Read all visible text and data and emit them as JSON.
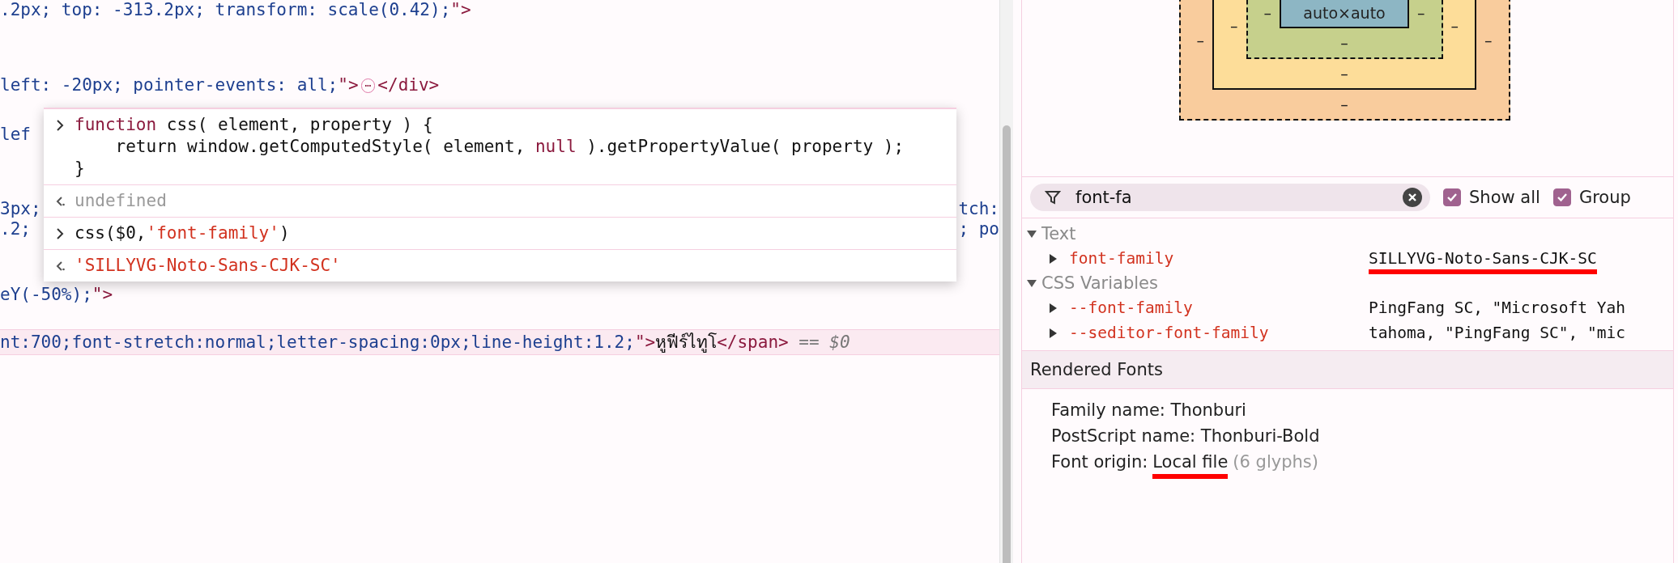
{
  "elements_tree": {
    "lines": [
      {
        "selected": false,
        "left": [
          {
            "kind": "value",
            "text": ".2px; top: -313.2px; transform: scale(0.42);"
          },
          {
            "kind": "tag",
            "text": "\">"
          }
        ]
      },
      {
        "selected": false,
        "left": [
          {
            "kind": "value",
            "text": "left: -20px; pointer-events: all;"
          },
          {
            "kind": "tag",
            "text": "\">"
          },
          {
            "kind": "ellipsis",
            "text": "⋯"
          },
          {
            "kind": "tag",
            "text": "</div>"
          }
        ]
      },
      {
        "selected": false,
        "left": [
          {
            "kind": "value",
            "text": "lef"
          }
        ]
      },
      {
        "selected": false,
        "left": [
          {
            "kind": "value",
            "text": "3px;"
          }
        ],
        "right": [
          {
            "kind": "value",
            "text": "tch:"
          }
        ]
      },
      {
        "selected": false,
        "left": [
          {
            "kind": "value",
            "text": ".2;"
          }
        ],
        "right": [
          {
            "kind": "value",
            "text": "; po"
          }
        ]
      },
      {
        "selected": false,
        "left": [
          {
            "kind": "value",
            "text": "eY(-50%);"
          },
          {
            "kind": "tag",
            "text": "\">"
          }
        ]
      },
      {
        "selected": true,
        "left": [
          {
            "kind": "value",
            "text": "nt:700;font-stretch:normal;letter-spacing:0px;line-height:1.2;"
          },
          {
            "kind": "tag",
            "text": "\">"
          },
          {
            "kind": "text",
            "text": "หูฟีร์ไทูโ"
          },
          {
            "kind": "tag",
            "text": "</span>"
          },
          {
            "kind": "comment",
            "text": " == $0"
          }
        ]
      }
    ]
  },
  "console_popup": {
    "entries": [
      {
        "kind": "input",
        "lines": [
          [
            {
              "kind": "keyword",
              "text": "function"
            },
            {
              "kind": "text",
              "text": " css( element, property ) {"
            }
          ],
          [
            {
              "kind": "text",
              "text": "    return window.getComputedStyle( element, "
            },
            {
              "kind": "keyword",
              "text": "null"
            },
            {
              "kind": "text",
              "text": " ).getPropertyValue( property );"
            }
          ],
          [
            {
              "kind": "text",
              "text": "}"
            }
          ]
        ]
      },
      {
        "kind": "output",
        "lines": [
          [
            {
              "kind": "muted",
              "text": "undefined"
            }
          ]
        ]
      },
      {
        "kind": "input",
        "lines": [
          [
            {
              "kind": "text",
              "text": "css($0,"
            },
            {
              "kind": "string",
              "text": "'font-family'"
            },
            {
              "kind": "text",
              "text": ")"
            }
          ]
        ]
      },
      {
        "kind": "output",
        "lines": [
          [
            {
              "kind": "string",
              "text": "'SILLYVG-Noto-Sans-CJK-SC'"
            }
          ]
        ]
      }
    ]
  },
  "box_model": {
    "content": "auto×auto",
    "padding": {
      "left": "–",
      "right": "–",
      "bottom": "–"
    },
    "border": {
      "left": "–",
      "right": "–",
      "bottom": "–"
    },
    "margin": {
      "left": "–",
      "right": "–",
      "bottom": "–"
    }
  },
  "filter": {
    "value": "font-fa",
    "show_all": {
      "label": "Show all",
      "checked": true
    },
    "group": {
      "label": "Group",
      "checked": true
    }
  },
  "computed": [
    {
      "label": "Text",
      "expanded": true,
      "children": [
        {
          "name": "font-family",
          "value": "SILLYVG-Noto-Sans-CJK-SC",
          "underlined": true
        }
      ]
    },
    {
      "label": "CSS Variables",
      "expanded": true,
      "children": [
        {
          "name": "--font-family",
          "value": "PingFang SC, \"Microsoft Yah",
          "underlined": false
        },
        {
          "name": "--seditor-font-family",
          "value": "tahoma, \"PingFang SC\", \"mic",
          "underlined": false
        }
      ]
    }
  ],
  "rendered_fonts": {
    "title": "Rendered Fonts",
    "family": "Family name: Thonburi",
    "postscript": "PostScript name: Thonburi-Bold",
    "origin_label": "Font origin:",
    "origin": "Local file",
    "origin_underlined": true,
    "glyphs": "(6 glyphs)"
  }
}
